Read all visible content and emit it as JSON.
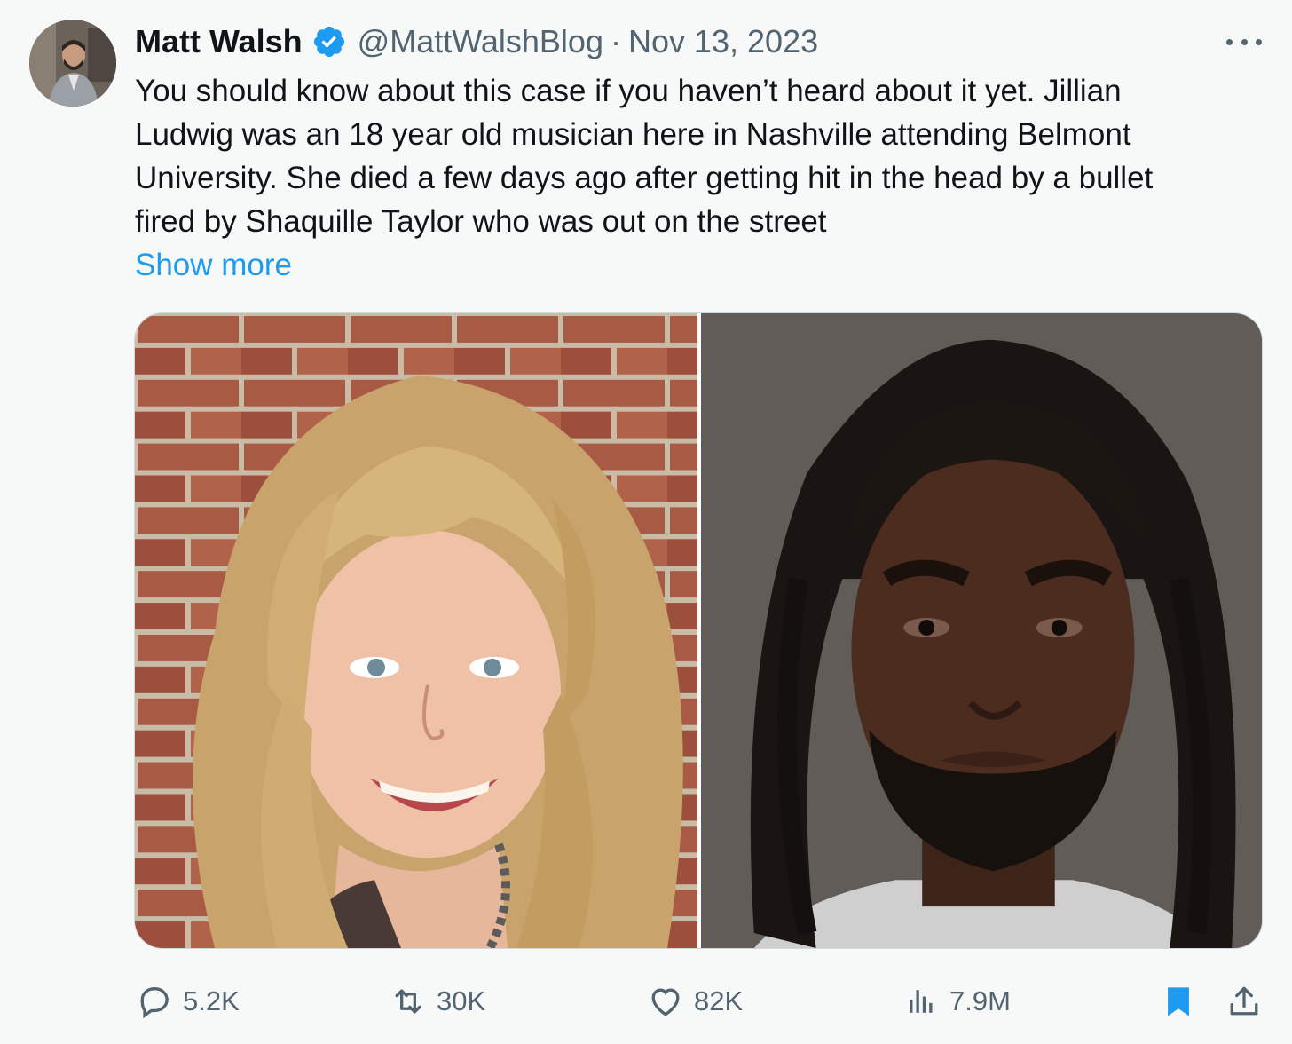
{
  "post": {
    "author_name": "Matt Walsh",
    "handle": "@MattWalshBlog",
    "separator": "·",
    "date": "Nov 13, 2023",
    "text_lines": [
      "You should know about this case if you haven’t heard about it yet. Jillian",
      "Ludwig was an 18 year old musician here in Nashville attending Belmont",
      "University. She died a few days ago after getting hit in the head by a bullet",
      "fired by Shaquille Taylor who was out on the street"
    ],
    "show_more_label": "Show more"
  },
  "media": {
    "images": [
      {
        "icon": "photo-young-woman-smiling"
      },
      {
        "icon": "photo-man-mugshot"
      }
    ]
  },
  "actions": {
    "replies": "5.2K",
    "reposts": "30K",
    "likes": "82K",
    "views": "7.9M"
  },
  "colors": {
    "accent": "#1d9bf0",
    "muted_text": "#536471",
    "background": "#f7f9f9"
  }
}
